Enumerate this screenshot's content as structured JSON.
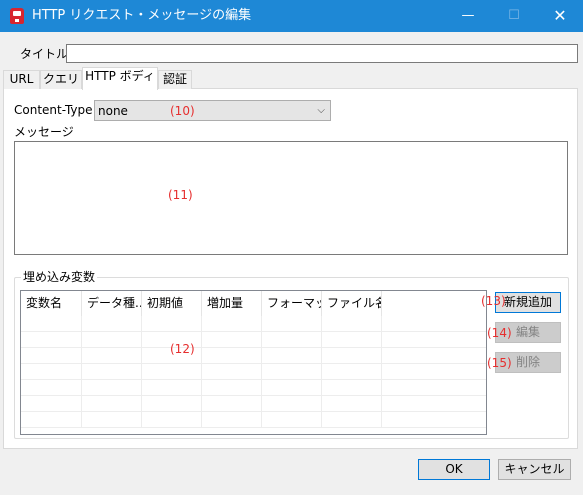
{
  "window": {
    "title": "HTTP リクエスト・メッセージの編集",
    "minimize_glyph": "—",
    "maximize_glyph": "☐",
    "close_glyph": "✕"
  },
  "form": {
    "title_label": "タイトル",
    "title_value": ""
  },
  "tabs": [
    {
      "label": "URL"
    },
    {
      "label": "クエリ"
    },
    {
      "label": "HTTP ボディ",
      "active": true
    },
    {
      "label": "認証"
    }
  ],
  "body": {
    "content_type_label": "Content-Type",
    "content_type_value": "none",
    "message_label": "メッセージ",
    "message_value": "",
    "embedded_vars_label": "埋め込み変数",
    "columns": [
      "変数名",
      "データ種...",
      "初期値",
      "増加量",
      "フォーマッ...",
      "ファイル名"
    ],
    "row_count": 7,
    "new_button": "新規追加",
    "edit_button": "編集",
    "delete_button": "削除"
  },
  "annotations": {
    "n10": "(10)",
    "n11": "(11)",
    "n12": "(12)",
    "n13": "(13)",
    "n14": "(14)",
    "n15": "(15)"
  },
  "footer": {
    "ok_button": "OK",
    "cancel_button": "キャンセル"
  },
  "colors": {
    "titlebar": "#1e88d6",
    "annotation": "#e62e2e",
    "accent_border": "#0078d7"
  },
  "icons": {
    "app": "app-icon",
    "dropdown": "chevron-down-icon"
  }
}
